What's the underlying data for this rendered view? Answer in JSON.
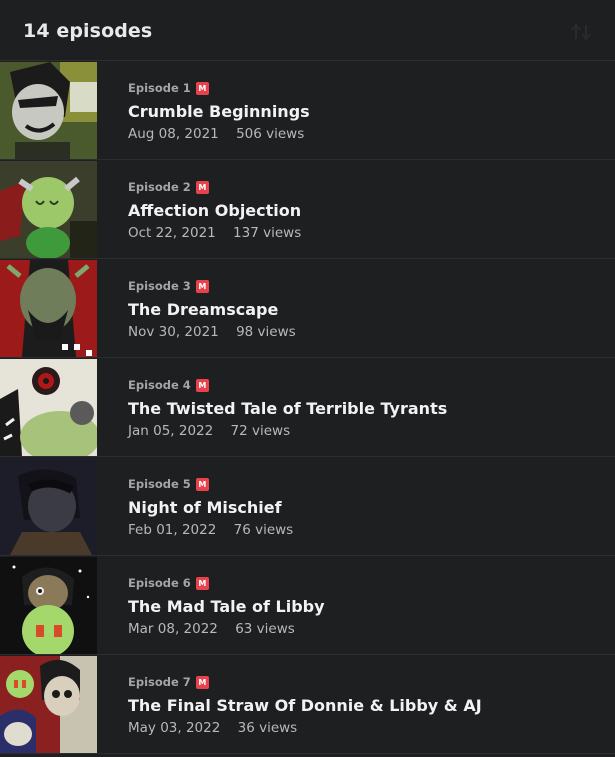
{
  "header": {
    "title": "14 episodes",
    "sort_icon": "sort-arrows-icon"
  },
  "colors": {
    "background": "#1e1f21",
    "badge": "#e8434d",
    "divider": "#2c2d30"
  },
  "episodes": [
    {
      "label": "Episode 1",
      "badge": "M",
      "title": "Crumble Beginnings",
      "date": "Aug 08, 2021",
      "views": "506 views"
    },
    {
      "label": "Episode 2",
      "badge": "M",
      "title": "Affection Objection",
      "date": "Oct 22, 2021",
      "views": "137 views"
    },
    {
      "label": "Episode 3",
      "badge": "M",
      "title": "The Dreamscape",
      "date": "Nov 30, 2021",
      "views": "98 views"
    },
    {
      "label": "Episode 4",
      "badge": "M",
      "title": "The Twisted Tale of Terrible Tyrants",
      "date": "Jan 05, 2022",
      "views": "72 views"
    },
    {
      "label": "Episode 5",
      "badge": "M",
      "title": "Night of Mischief",
      "date": "Feb 01, 2022",
      "views": "76 views"
    },
    {
      "label": "Episode 6",
      "badge": "M",
      "title": "The Mad Tale of Libby",
      "date": "Mar 08, 2022",
      "views": "63 views"
    },
    {
      "label": "Episode 7",
      "badge": "M",
      "title": "The Final Straw Of Donnie & Libby & AJ",
      "date": "May 03, 2022",
      "views": "36 views"
    }
  ]
}
